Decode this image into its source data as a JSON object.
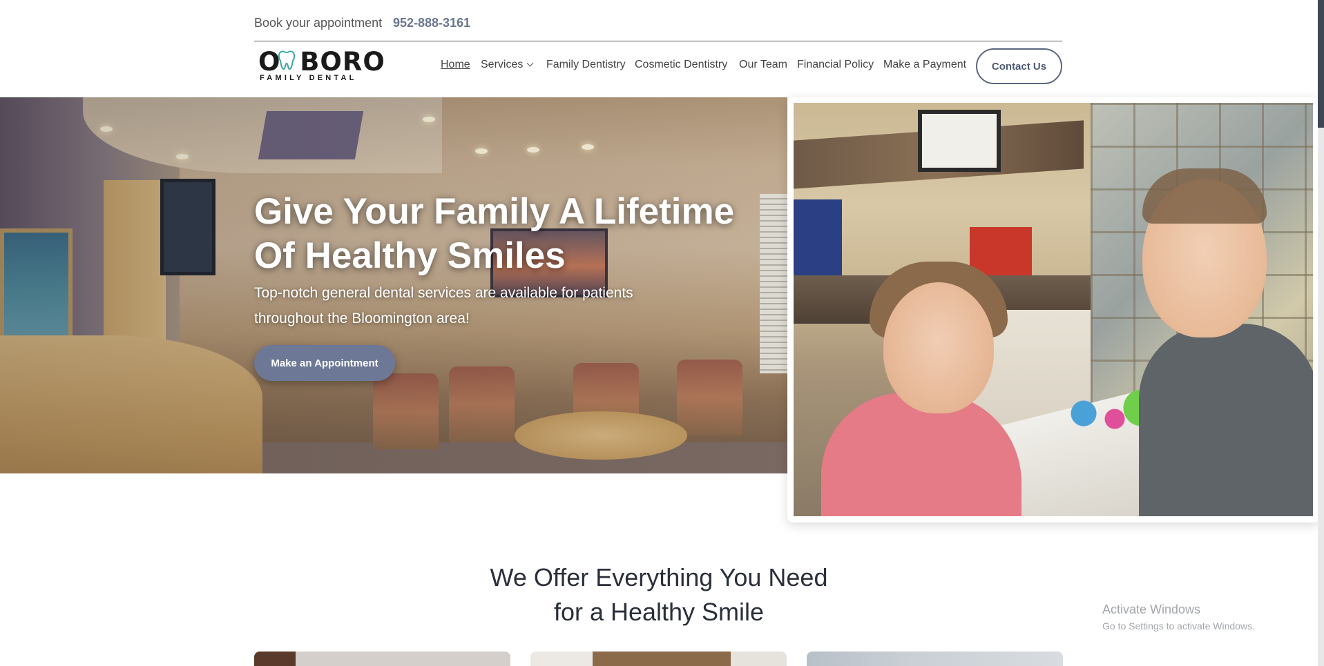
{
  "topbar": {
    "book_label": "Book your appointment",
    "phone": "952-888-3161"
  },
  "logo": {
    "word": "O BORO",
    "sub": "FAMILY DENTAL"
  },
  "nav": {
    "items": [
      {
        "label": "Home"
      },
      {
        "label": "Services"
      },
      {
        "label": "Family Dentistry"
      },
      {
        "label": "Cosmetic Dentistry"
      },
      {
        "label": "Our Team"
      },
      {
        "label": "Financial Policy"
      },
      {
        "label": "Make a Payment"
      }
    ],
    "contact_label": "Contact Us"
  },
  "hero": {
    "title": "Give Your Family A Lifetime Of Healthy Smiles",
    "subtitle": "Top-notch general dental services are available for patients throughout the Bloomington area!",
    "button_label": "Make an Appointment"
  },
  "offer": {
    "title_line1": "We Offer Everything You Need",
    "title_line2": "for a Healthy Smile"
  },
  "watermark": {
    "title": "Activate Windows",
    "subtitle": "Go to Settings to activate Windows."
  },
  "icons": {
    "dropdown": "chevron-down-icon",
    "logo_tooth": "tooth-icon"
  },
  "colors": {
    "accent": "#6c7896",
    "phone": "#6a7590",
    "contact_border": "#5a6680"
  }
}
